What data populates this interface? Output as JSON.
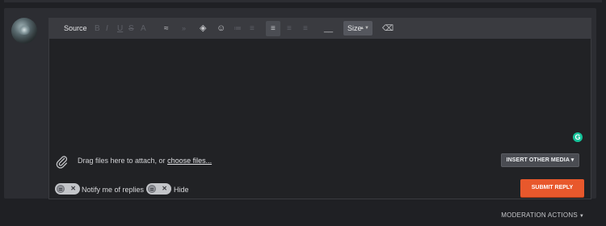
{
  "toolbar": {
    "source_label": "Source",
    "size_label": "Size"
  },
  "attach": {
    "text": "Drag files here to attach, or ",
    "link": "choose files..."
  },
  "insert_media_label": "INSERT OTHER MEDIA",
  "options": {
    "notify_label": "Notify me of replies",
    "hide_label": "Hide"
  },
  "submit_label": "SUBMIT REPLY",
  "moderation_label": "MODERATION ACTIONS",
  "colors": {
    "accent": "#e8582c",
    "panel": "#2c2d32",
    "editor": "#212225",
    "grammarly": "#15c39a"
  }
}
